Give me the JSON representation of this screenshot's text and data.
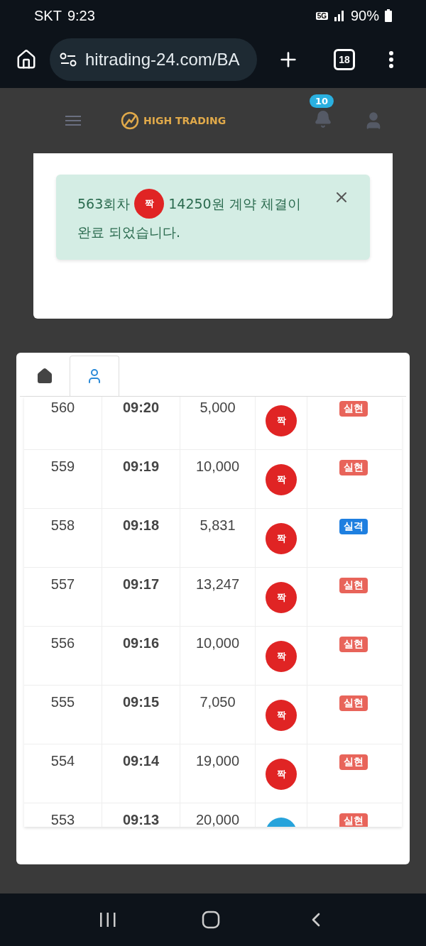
{
  "status_bar": {
    "carrier": "SKT",
    "time": "9:23",
    "network": "5G",
    "battery": "90%"
  },
  "browser": {
    "url": "hitrading-24.com/BA",
    "tab_count": "18"
  },
  "header": {
    "brand": "HIGH TRADING",
    "notification_count": "10"
  },
  "alert": {
    "round": "563회차",
    "pick": {
      "kind": "even",
      "label": "짝"
    },
    "message_line1": "14250원 계약 체결이",
    "message_line2": "완료 되었습니다."
  },
  "tabs": [
    {
      "kind": "home",
      "selected": false
    },
    {
      "kind": "user",
      "selected": true
    }
  ],
  "rows": [
    {
      "round": "560",
      "time": "09:20",
      "amount": "5,000",
      "pick": {
        "kind": "even",
        "label": "짝"
      },
      "result": {
        "kind": "win",
        "label": "실현"
      }
    },
    {
      "round": "559",
      "time": "09:19",
      "amount": "10,000",
      "pick": {
        "kind": "even",
        "label": "짝"
      },
      "result": {
        "kind": "win",
        "label": "실현"
      }
    },
    {
      "round": "558",
      "time": "09:18",
      "amount": "5,831",
      "pick": {
        "kind": "even",
        "label": "짝"
      },
      "result": {
        "kind": "loss",
        "label": "실격"
      }
    },
    {
      "round": "557",
      "time": "09:17",
      "amount": "13,247",
      "pick": {
        "kind": "even",
        "label": "짝"
      },
      "result": {
        "kind": "win",
        "label": "실현"
      }
    },
    {
      "round": "556",
      "time": "09:16",
      "amount": "10,000",
      "pick": {
        "kind": "even",
        "label": "짝"
      },
      "result": {
        "kind": "win",
        "label": "실현"
      }
    },
    {
      "round": "555",
      "time": "09:15",
      "amount": "7,050",
      "pick": {
        "kind": "even",
        "label": "짝"
      },
      "result": {
        "kind": "win",
        "label": "실현"
      }
    },
    {
      "round": "554",
      "time": "09:14",
      "amount": "19,000",
      "pick": {
        "kind": "even",
        "label": "짝"
      },
      "result": {
        "kind": "win",
        "label": "실현"
      }
    },
    {
      "round": "553",
      "time": "09:13",
      "amount": "20,000",
      "pick": {
        "kind": "odd"
      },
      "result": {
        "kind": "win",
        "label": "실현"
      }
    }
  ]
}
